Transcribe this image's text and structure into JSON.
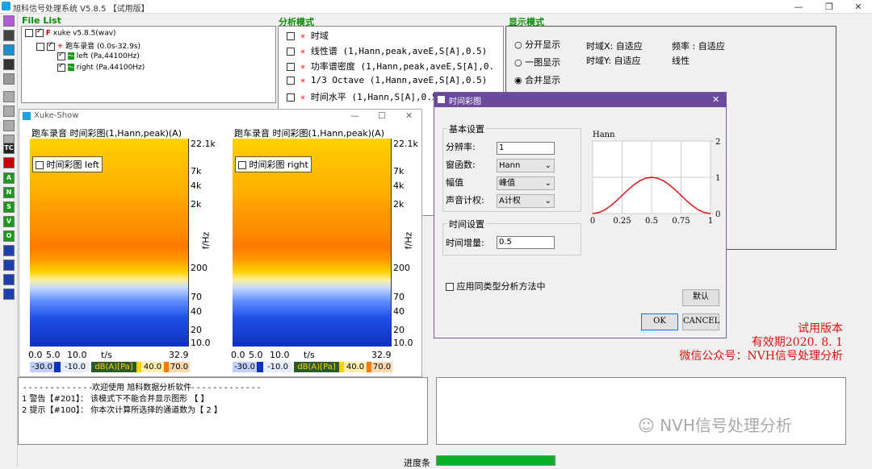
{
  "window": {
    "title": "旭科信号处理系统 V5.8.5 【试用版】",
    "min": "—",
    "max": "❐",
    "close": "✕"
  },
  "toolbar": {
    "labels": [
      "A",
      "N",
      "S",
      "V",
      "O",
      "TC"
    ]
  },
  "file_list": {
    "title": "File List",
    "root": "xuke v5.8.5(wav)",
    "record": "跑车录音 (0.0s-32.9s)",
    "channels": [
      "left (Pa,44100Hz)",
      "right (Pa,44100Hz)"
    ]
  },
  "analysis": {
    "title": "分析模式",
    "items": [
      "时域",
      "线性谱 (1,Hann,peak,aveE,S[A],0.5)",
      "功率谱密度 (1,Hann,peak,aveE,S[A],0.",
      "1/3 Octave (1,Hann,aveE,S[A],0.5)",
      "时间水平 (1,Hann,S[A],0.5)"
    ]
  },
  "display": {
    "title": "显示模式",
    "options": [
      "分开显示",
      "一图显示",
      "合并显示"
    ],
    "selected": 2,
    "time_x": "时域X: 自适应",
    "time_y": "时域Y: 自适应",
    "freq": "频率 : 自适应",
    "linear": "线性"
  },
  "show": {
    "title": "Xuke-Show",
    "plots": [
      {
        "caption": "跑车录音 时间彩图(1,Hann,peak)(A)",
        "legend": "时间彩图 left"
      },
      {
        "caption": "跑车录音 时间彩图(1,Hann,peak)(A)",
        "legend": "时间彩图 right"
      }
    ],
    "yticks": [
      "22.1k",
      "7k",
      "4k",
      "2k",
      "f/Hz",
      "200",
      "70",
      "40",
      "20",
      "10.0"
    ],
    "xticks": [
      "0.0",
      "5.0",
      "10.0",
      "t/s",
      "32.9"
    ],
    "colorbar": [
      "-30.0",
      "-10.0",
      "dB(A)[Pa]",
      "40.0",
      "70.0"
    ]
  },
  "dialog": {
    "title": "时间彩图",
    "basic": "基本设置",
    "resolution_label": "分辨率:",
    "resolution": "1",
    "window_label": "窗函数:",
    "window": "Hann",
    "amp_label": "幅值",
    "amp": "峰值",
    "weight_label": "声音计权:",
    "weight": "A计权",
    "time_group": "时间设置",
    "increment_label": "时间增量:",
    "increment": "0.5",
    "apply_same": "应用同类型分析方法中",
    "default_btn": "默认",
    "ok": "OK",
    "cancel": "CANCEL",
    "chart_title": "Hann",
    "x_ticks": [
      "0",
      "0.25",
      "0.5",
      "0.75",
      "1"
    ],
    "y_ticks": [
      "2",
      "1",
      "0"
    ]
  },
  "trial": {
    "line1": "试用版本",
    "line2": "有效期2020. 8. 1",
    "line3": "微信公众号：NVH信号处理分析"
  },
  "log": {
    "header": "- - - - - - - - - - - - -欢迎使用 旭科数据分析软件- - - - - - - - - - - - -",
    "lines": [
      "1  警告【#201】： 该模式下不能合并显示图形 【  】",
      "2  提示【#100】： 你本次计算所选择的通道数为【 2 】"
    ]
  },
  "watermark": "NVH信号处理分析",
  "progress": {
    "label": "进度条",
    "value": 1.0
  },
  "chart_data": {
    "type": "line",
    "title": "Hann",
    "x": [
      0,
      0.05,
      0.1,
      0.15,
      0.2,
      0.25,
      0.3,
      0.35,
      0.4,
      0.45,
      0.5,
      0.55,
      0.6,
      0.65,
      0.7,
      0.75,
      0.8,
      0.85,
      0.9,
      0.95,
      1
    ],
    "y": [
      0,
      0.024,
      0.095,
      0.206,
      0.345,
      0.5,
      0.655,
      0.794,
      0.905,
      0.976,
      1,
      0.976,
      0.905,
      0.794,
      0.655,
      0.5,
      0.345,
      0.206,
      0.095,
      0.024,
      0
    ],
    "xlim": [
      0,
      1
    ],
    "ylim": [
      0,
      2
    ],
    "color": "#e01010"
  }
}
